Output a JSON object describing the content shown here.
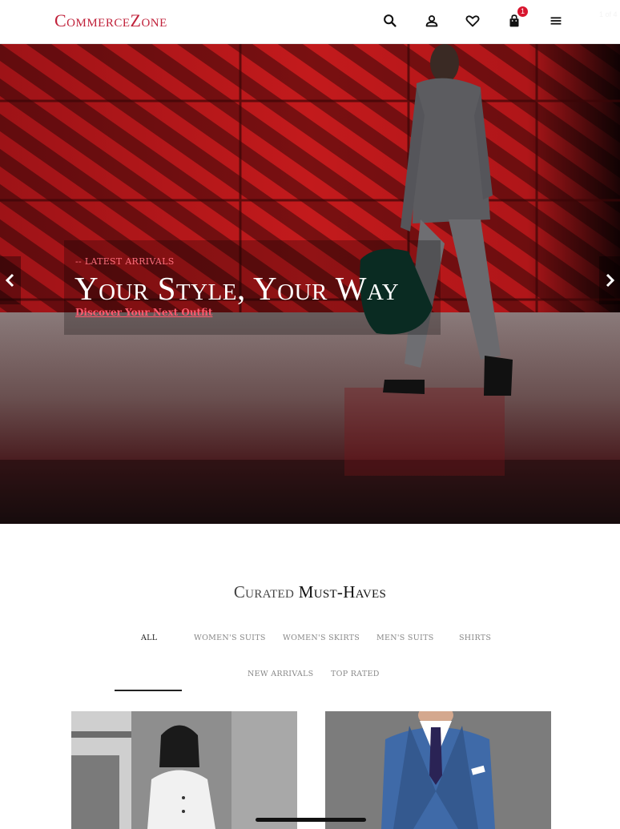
{
  "header": {
    "logo": "CommerceZone",
    "cart_count": "1",
    "slide_counter": "1 of 4",
    "icons": [
      "search-icon",
      "user-icon",
      "heart-icon",
      "bag-icon",
      "menu-icon"
    ]
  },
  "hero": {
    "eyebrow": "-- LATEST ARRIVALS",
    "title": "Your Style, Your Way",
    "link": "Discover Your Next Outfit"
  },
  "section": {
    "title_light": "Curated",
    "title_dark": "Must-Haves",
    "tabs": [
      "ALL",
      "WOMEN'S SUITS",
      "WOMEN'S SKIRTS",
      "MEN'S SUITS",
      "SHIRTS",
      "NEW ARRIVALS",
      "TOP RATED"
    ],
    "active_tab": "ALL"
  },
  "colors": {
    "brand": "#c0213a",
    "badge": "#d8152e",
    "link": "#ff5a6e"
  }
}
